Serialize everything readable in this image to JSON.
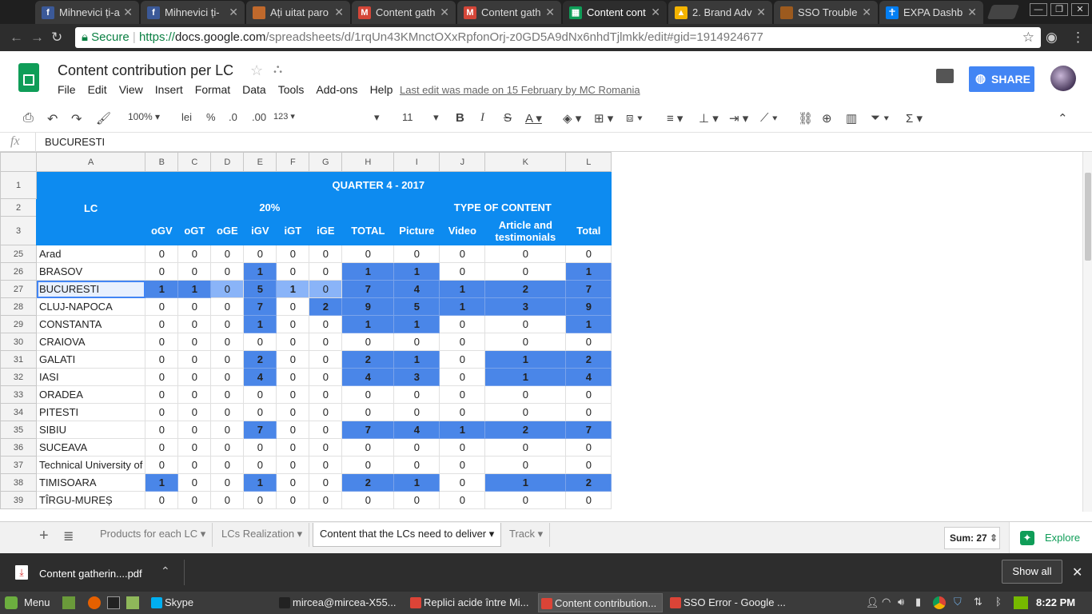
{
  "browser": {
    "tabs": [
      {
        "title": "Mihnevici ți-a",
        "icon": "facebook-icon",
        "color": "#3b5998",
        "glyph": "f"
      },
      {
        "title": "Mihnevici ți-",
        "icon": "facebook-icon",
        "color": "#3b5998",
        "glyph": "f"
      },
      {
        "title": "Ați uitat paro",
        "icon": "page-icon",
        "color": "#c0692c",
        "glyph": ""
      },
      {
        "title": "Content gath",
        "icon": "gmail-icon",
        "color": "#d44638",
        "glyph": "M"
      },
      {
        "title": "Content gath",
        "icon": "gmail-icon",
        "color": "#d44638",
        "glyph": "M"
      },
      {
        "title": "Content cont",
        "icon": "sheets-icon",
        "color": "#0f9d58",
        "glyph": "▦"
      },
      {
        "title": "2. Brand Adv",
        "icon": "drive-icon",
        "color": "#f4b400",
        "glyph": "▲"
      },
      {
        "title": "SSO Trouble",
        "icon": "page-icon",
        "color": "#9c5a1e",
        "glyph": ""
      },
      {
        "title": "EXPA Dashb",
        "icon": "expa-icon",
        "color": "#037ef3",
        "glyph": "☥"
      }
    ],
    "secure_label": "Secure",
    "url_scheme": "https://",
    "url_host": "docs.google.com",
    "url_path": "/spreadsheets/d/1rqUn43KMnctOXxRpfonOrj-z0GD5A9dNx6nhdTjlmkk/edit#gid=1914924677"
  },
  "doc": {
    "title": "Content contribution per LC",
    "menu": [
      "File",
      "Edit",
      "View",
      "Insert",
      "Format",
      "Data",
      "Tools",
      "Add-ons",
      "Help"
    ],
    "last_edit": "Last edit was made on 15 February by MC Romania",
    "share_label": "SHARE"
  },
  "toolbar": {
    "zoom": "100%",
    "currency": "lei",
    "percent": "%",
    "dec_less": ".0",
    "dec_more": ".00",
    "more_formats": "123",
    "font_size": "11"
  },
  "formula_bar": {
    "fx": "fx",
    "value": "BUCURESTI"
  },
  "sheet": {
    "col_letters": [
      "A",
      "B",
      "C",
      "D",
      "E",
      "F",
      "G",
      "H",
      "I",
      "J",
      "K",
      "L"
    ],
    "header_row_numbers": [
      "1",
      "2",
      "3"
    ],
    "lc_header": "LC",
    "quarter_header": "QUARTER 4 - 2017",
    "pct_header": "20%",
    "type_header": "TYPE OF CONTENT",
    "sub_headers": [
      "oGV",
      "oGT",
      "oGE",
      "iGV",
      "iGT",
      "iGE",
      "TOTAL",
      "Picture",
      "Video",
      "Article and testimonials",
      "Total"
    ],
    "rows": [
      {
        "num": "25",
        "lc": "Arad",
        "vals": [
          "0",
          "0",
          "0",
          "0",
          "0",
          "0",
          "0",
          "0",
          "0",
          "0",
          "0"
        ]
      },
      {
        "num": "26",
        "lc": "BRASOV",
        "vals": [
          "0",
          "0",
          "0",
          "1",
          "0",
          "0",
          "1",
          "1",
          "0",
          "0",
          "1"
        ]
      },
      {
        "num": "27",
        "lc": "BUCURESTI",
        "vals": [
          "1",
          "1",
          "0",
          "5",
          "1",
          "0",
          "7",
          "4",
          "1",
          "2",
          "7"
        ]
      },
      {
        "num": "28",
        "lc": "CLUJ-NAPOCA",
        "vals": [
          "0",
          "0",
          "0",
          "7",
          "0",
          "2",
          "9",
          "5",
          "1",
          "3",
          "9"
        ]
      },
      {
        "num": "29",
        "lc": "CONSTANTA",
        "vals": [
          "0",
          "0",
          "0",
          "1",
          "0",
          "0",
          "1",
          "1",
          "0",
          "0",
          "1"
        ]
      },
      {
        "num": "30",
        "lc": "CRAIOVA",
        "vals": [
          "0",
          "0",
          "0",
          "0",
          "0",
          "0",
          "0",
          "0",
          "0",
          "0",
          "0"
        ]
      },
      {
        "num": "31",
        "lc": "GALATI",
        "vals": [
          "0",
          "0",
          "0",
          "2",
          "0",
          "0",
          "2",
          "1",
          "0",
          "1",
          "2"
        ]
      },
      {
        "num": "32",
        "lc": "IASI",
        "vals": [
          "0",
          "0",
          "0",
          "4",
          "0",
          "0",
          "4",
          "3",
          "0",
          "1",
          "4"
        ]
      },
      {
        "num": "33",
        "lc": "ORADEA",
        "vals": [
          "0",
          "0",
          "0",
          "0",
          "0",
          "0",
          "0",
          "0",
          "0",
          "0",
          "0"
        ]
      },
      {
        "num": "34",
        "lc": "PITESTI",
        "vals": [
          "0",
          "0",
          "0",
          "0",
          "0",
          "0",
          "0",
          "0",
          "0",
          "0",
          "0"
        ]
      },
      {
        "num": "35",
        "lc": "SIBIU",
        "vals": [
          "0",
          "0",
          "0",
          "7",
          "0",
          "0",
          "7",
          "4",
          "1",
          "2",
          "7"
        ]
      },
      {
        "num": "36",
        "lc": "SUCEAVA",
        "vals": [
          "0",
          "0",
          "0",
          "0",
          "0",
          "0",
          "0",
          "0",
          "0",
          "0",
          "0"
        ]
      },
      {
        "num": "37",
        "lc": "Technical University of",
        "vals": [
          "0",
          "0",
          "0",
          "0",
          "0",
          "0",
          "0",
          "0",
          "0",
          "0",
          "0"
        ]
      },
      {
        "num": "38",
        "lc": "TIMISOARA",
        "vals": [
          "1",
          "0",
          "0",
          "1",
          "0",
          "0",
          "2",
          "1",
          "0",
          "1",
          "2"
        ]
      },
      {
        "num": "39",
        "lc": "TÎRGU-MUREȘ",
        "vals": [
          "0",
          "0",
          "0",
          "0",
          "0",
          "0",
          "0",
          "0",
          "0",
          "0",
          "0"
        ]
      }
    ]
  },
  "sheet_tabs": [
    "Products for each LC",
    "LCs Realization",
    "Content that the LCs need to deliver",
    "Track"
  ],
  "active_sheet_tab": "Content that the LCs need to deliver",
  "sum_label": "Sum: 27",
  "explore_label": "Explore",
  "download": {
    "file": "Content gatherin....pdf",
    "show_all": "Show all"
  },
  "taskbar": {
    "menu_label": "Menu",
    "tasks": [
      "Skype",
      "mircea@mircea-X55...",
      "Replici acide între Mi...",
      "Content contribution...",
      "SSO Error - Google ..."
    ],
    "clock": "8:22 PM"
  },
  "colors": {
    "header_blue": "#0d8bf0",
    "highlight_blue": "#4a86e8",
    "share_blue": "#4285f4",
    "sheets_green": "#0f9d58"
  }
}
